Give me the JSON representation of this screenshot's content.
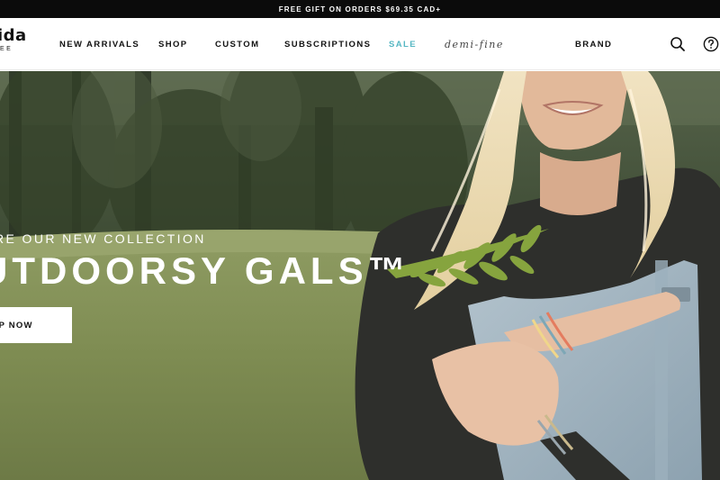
{
  "announcement": {
    "text": "FREE GIFT ON ORDERS $69.35 CAD+"
  },
  "logo": {
    "main": "ida",
    "sub": "EE"
  },
  "nav": {
    "items": [
      {
        "label": "NEW ARRIVALS"
      },
      {
        "label": "SHOP"
      },
      {
        "label": "CUSTOM"
      },
      {
        "label": "SUBSCRIPTIONS"
      },
      {
        "label": "SALE"
      },
      {
        "label": "demi-fine"
      },
      {
        "label": "BRAND"
      }
    ]
  },
  "icons": {
    "search": "search-icon",
    "help": "help-icon"
  },
  "hero": {
    "eyebrow": "RE OUR NEW COLLECTION",
    "title": "UTDOORSY GALS™",
    "cta": "OP NOW"
  },
  "colors": {
    "announcement_bg": "#0b0b0b",
    "sale_accent": "#56b7c3",
    "forest_dark": "#2f3a2a",
    "meadow": "#8a9a5e"
  }
}
